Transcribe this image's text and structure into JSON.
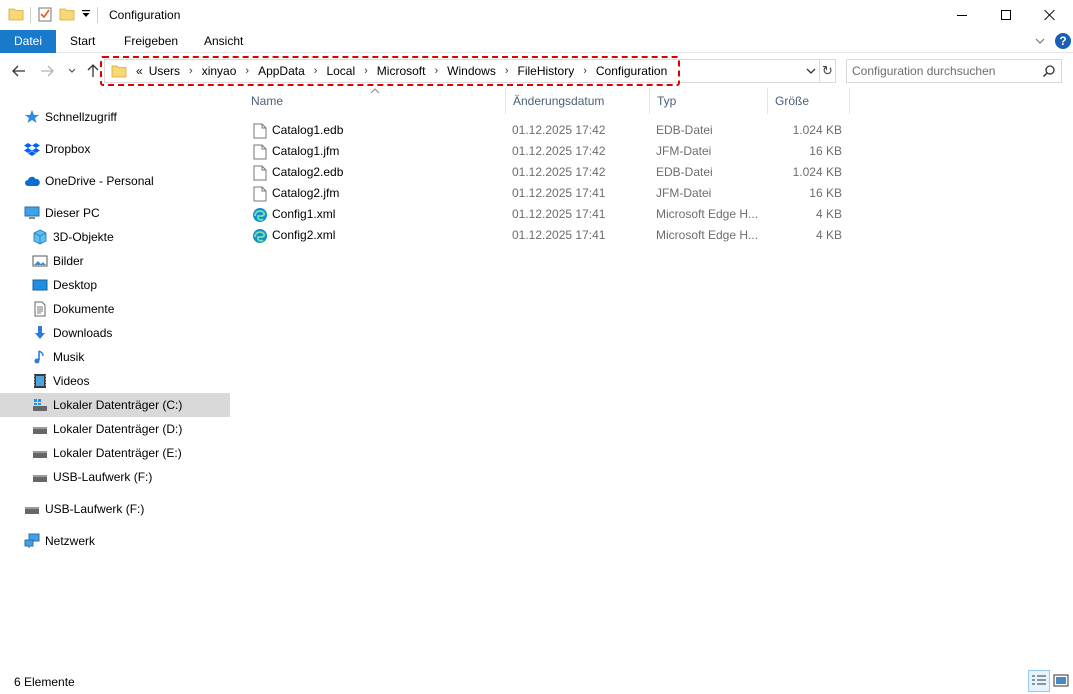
{
  "window": {
    "title": "Configuration"
  },
  "ribbon": {
    "tabs": [
      "Datei",
      "Start",
      "Freigeben",
      "Ansicht"
    ],
    "help_label": "?"
  },
  "address": {
    "overflow": "«",
    "crumbs": [
      "Users",
      "xinyao",
      "AppData",
      "Local",
      "Microsoft",
      "Windows",
      "FileHistory",
      "Configuration"
    ],
    "refresh_label": "↻"
  },
  "search": {
    "placeholder": "Configuration durchsuchen"
  },
  "sidebar": {
    "items": [
      {
        "label": "Schnellzugriff",
        "icon": "star-icon"
      },
      {
        "label": "Dropbox",
        "icon": "dropbox-icon"
      },
      {
        "label": "OneDrive - Personal",
        "icon": "cloud-icon"
      },
      {
        "label": "Dieser PC",
        "icon": "pc-icon"
      },
      {
        "label": "3D-Objekte",
        "icon": "cube-icon"
      },
      {
        "label": "Bilder",
        "icon": "pictures-icon"
      },
      {
        "label": "Desktop",
        "icon": "desktop-icon"
      },
      {
        "label": "Dokumente",
        "icon": "document-icon"
      },
      {
        "label": "Downloads",
        "icon": "download-icon"
      },
      {
        "label": "Musik",
        "icon": "music-icon"
      },
      {
        "label": "Videos",
        "icon": "video-icon"
      },
      {
        "label": "Lokaler Datenträger (C:)",
        "icon": "drive-c-icon",
        "selected": true
      },
      {
        "label": "Lokaler Datenträger (D:)",
        "icon": "drive-icon"
      },
      {
        "label": "Lokaler Datenträger (E:)",
        "icon": "drive-icon"
      },
      {
        "label": "USB-Laufwerk (F:)",
        "icon": "usb-drive-icon"
      },
      {
        "label": "USB-Laufwerk (F:)",
        "icon": "usb-drive-icon"
      },
      {
        "label": "Netzwerk",
        "icon": "network-icon"
      }
    ]
  },
  "table": {
    "columns": [
      "Name",
      "Änderungsdatum",
      "Typ",
      "Größe"
    ],
    "rows": [
      {
        "name": "Catalog1.edb",
        "date": "01.12.2025 17:42",
        "type": "EDB-Datei",
        "size": "1.024 KB",
        "icon": "file-icon"
      },
      {
        "name": "Catalog1.jfm",
        "date": "01.12.2025 17:42",
        "type": "JFM-Datei",
        "size": "16 KB",
        "icon": "file-icon"
      },
      {
        "name": "Catalog2.edb",
        "date": "01.12.2025 17:42",
        "type": "EDB-Datei",
        "size": "1.024 KB",
        "icon": "file-icon"
      },
      {
        "name": "Catalog2.jfm",
        "date": "01.12.2025 17:41",
        "type": "JFM-Datei",
        "size": "16 KB",
        "icon": "file-icon"
      },
      {
        "name": "Config1.xml",
        "date": "01.12.2025 17:41",
        "type": "Microsoft Edge H...",
        "size": "4 KB",
        "icon": "edge-icon"
      },
      {
        "name": "Config2.xml",
        "date": "01.12.2025 17:41",
        "type": "Microsoft Edge H...",
        "size": "4 KB",
        "icon": "edge-icon"
      }
    ]
  },
  "status": {
    "count_text": "6 Elemente"
  },
  "colors": {
    "accent": "#1979ca",
    "highlight": "#e00000",
    "selected_bg": "#d9d9d9",
    "folder": "#f8d775"
  }
}
